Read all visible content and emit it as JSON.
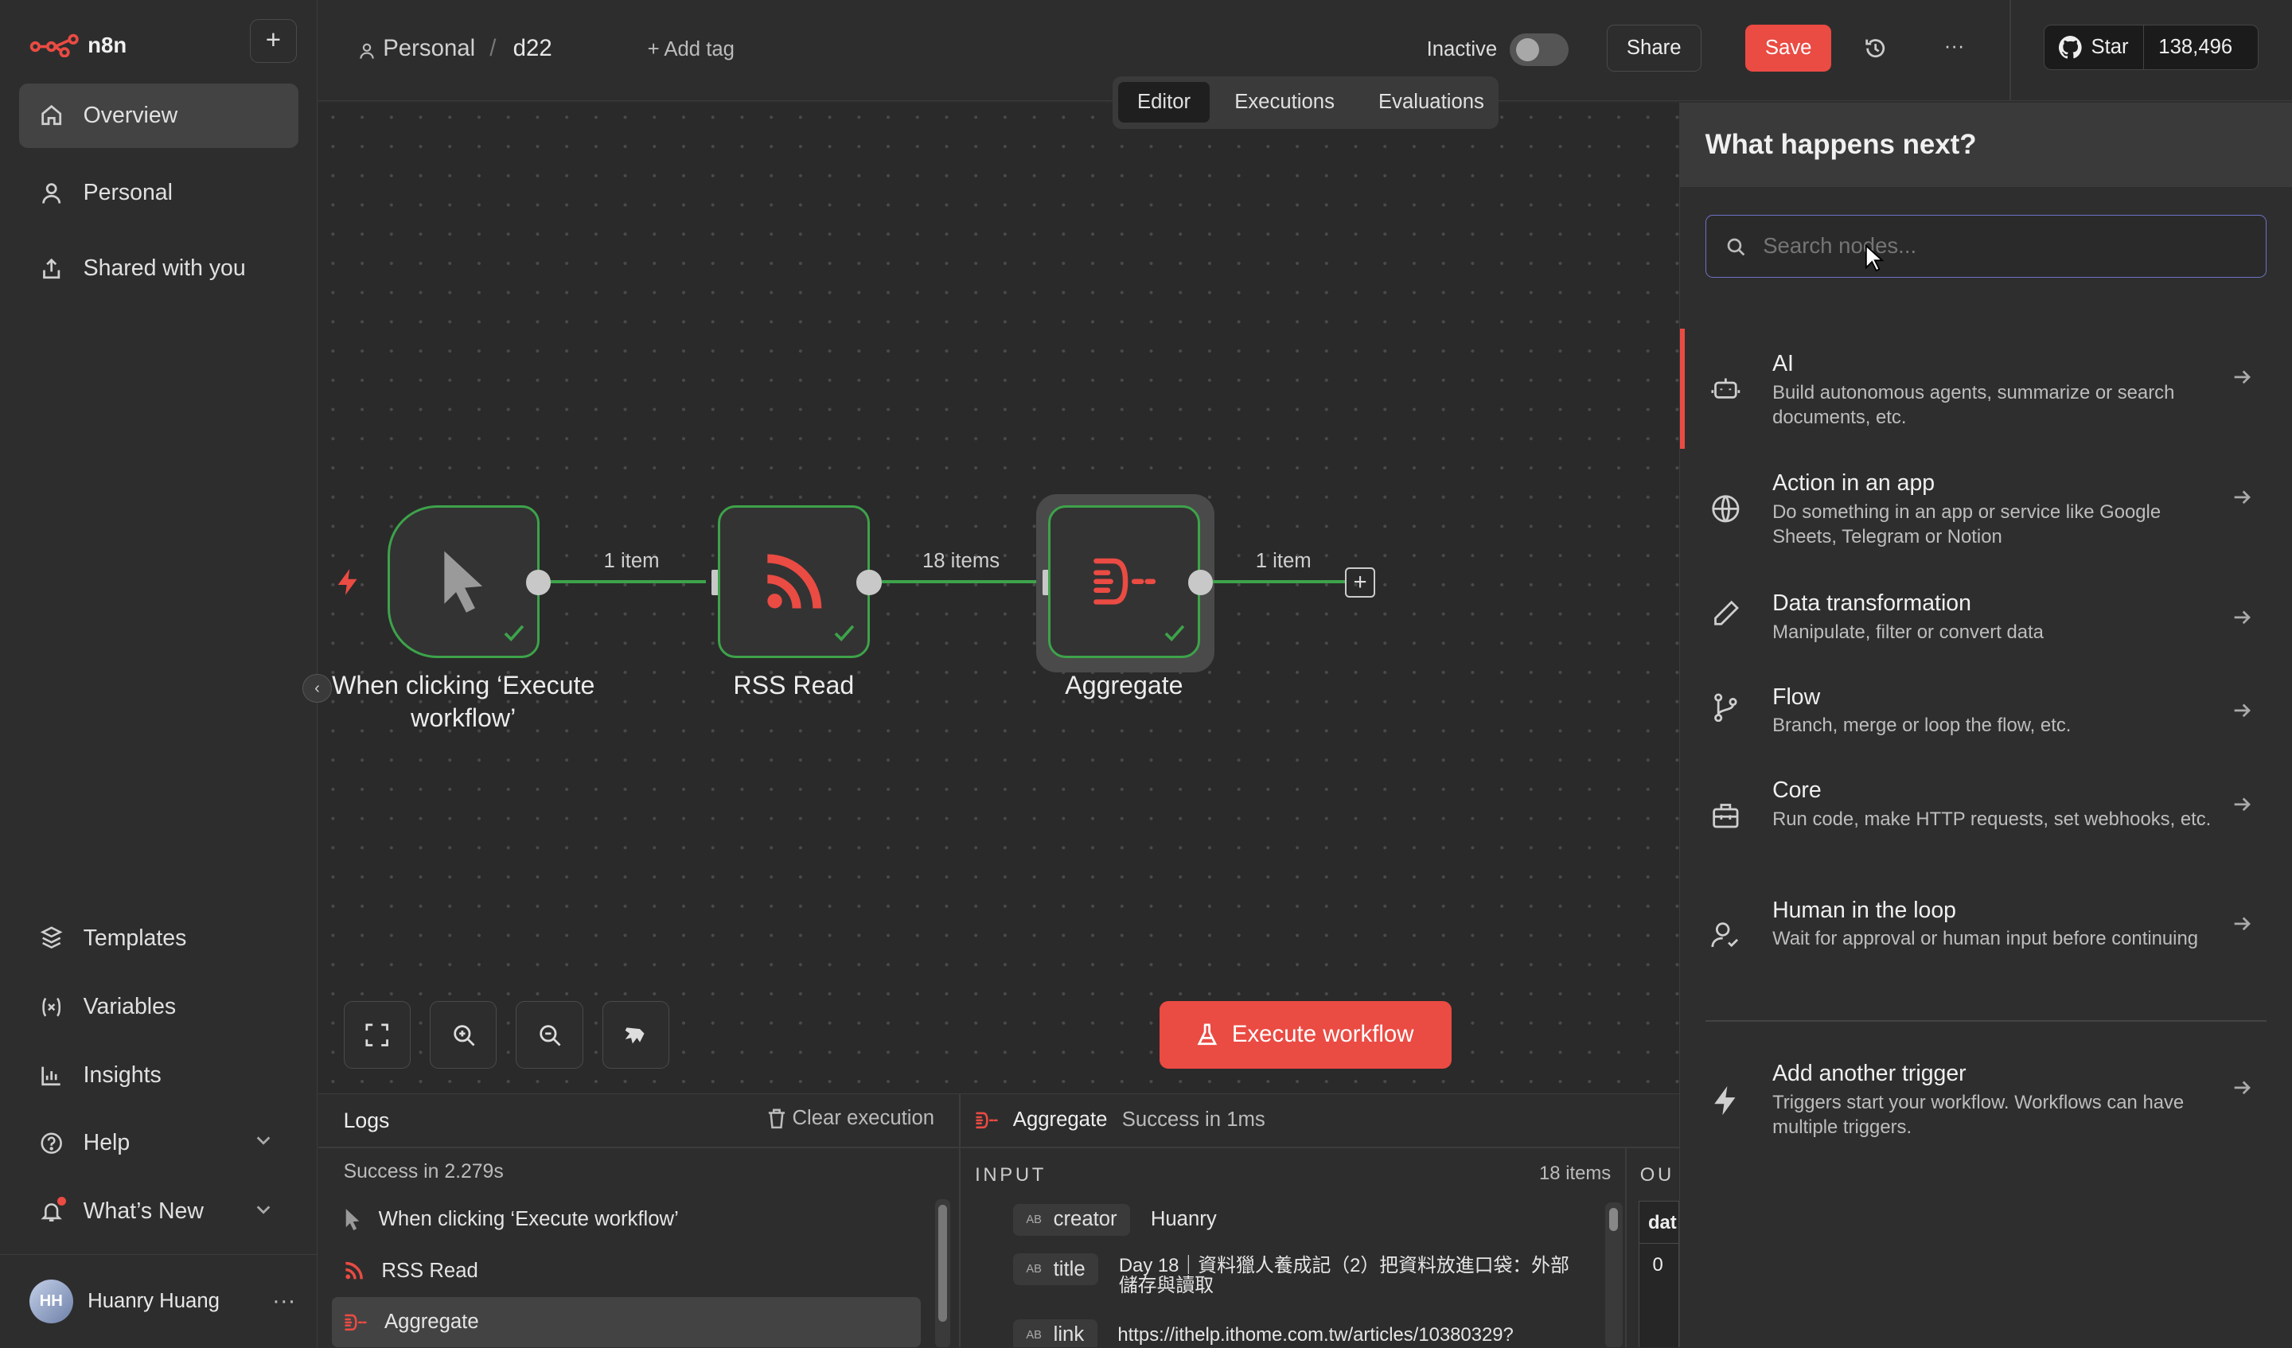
{
  "app": {
    "name": "n8n"
  },
  "sidebar": {
    "add_label": "+",
    "items": [
      {
        "label": "Overview"
      },
      {
        "label": "Personal"
      },
      {
        "label": "Shared with you"
      }
    ],
    "bottom_items": [
      {
        "label": "Templates"
      },
      {
        "label": "Variables"
      },
      {
        "label": "Insights"
      },
      {
        "label": "Help"
      },
      {
        "label": "What’s New"
      }
    ],
    "user": {
      "initials": "HH",
      "name": "Huanry Huang"
    }
  },
  "header": {
    "project": "Personal",
    "separator": "/",
    "workflow_name": "d22",
    "add_tag": "+ Add tag",
    "status_label": "Inactive",
    "share_label": "Share",
    "save_label": "Save",
    "more_label": "···",
    "github_star_label": "Star",
    "github_star_count": "138,496"
  },
  "tabs": [
    {
      "label": "Editor",
      "active": true
    },
    {
      "label": "Executions",
      "active": false
    },
    {
      "label": "Evaluations",
      "active": false
    }
  ],
  "canvas": {
    "nodes": [
      {
        "label": "When clicking ‘Execute workflow’"
      },
      {
        "label": "RSS Read"
      },
      {
        "label": "Aggregate"
      }
    ],
    "connections": [
      {
        "label": "1 item"
      },
      {
        "label": "18 items"
      },
      {
        "label": "1 item"
      }
    ],
    "execute_label": "Execute workflow"
  },
  "panel": {
    "title": "What happens next?",
    "search_placeholder": "Search nodes...",
    "categories": [
      {
        "title": "AI",
        "desc": "Build autonomous agents, summarize or search documents, etc.",
        "icon": "robot-icon"
      },
      {
        "title": "Action in an app",
        "desc": "Do something in an app or service like Google Sheets, Telegram or Notion",
        "icon": "globe-icon"
      },
      {
        "title": "Data transformation",
        "desc": "Manipulate, filter or convert data",
        "icon": "pen-icon"
      },
      {
        "title": "Flow",
        "desc": "Branch, merge or loop the flow, etc.",
        "icon": "branch-icon"
      },
      {
        "title": "Core",
        "desc": "Run code, make HTTP requests, set webhooks, etc.",
        "icon": "toolbox-icon"
      },
      {
        "title": "Human in the loop",
        "desc": "Wait for approval or human input before continuing",
        "icon": "user-check-icon"
      }
    ],
    "trigger": {
      "title": "Add another trigger",
      "desc": "Triggers start your workflow. Workflows can have multiple triggers.",
      "icon": "bolt-icon"
    }
  },
  "logs": {
    "title": "Logs",
    "clear_label": "Clear execution",
    "summary": "Success in 2.279s",
    "entries": [
      {
        "label": "When clicking ‘Execute workflow’"
      },
      {
        "label": "RSS Read"
      },
      {
        "label": "Aggregate"
      }
    ],
    "detail": {
      "node": "Aggregate",
      "status": "Success in 1ms",
      "input_label": "INPUT",
      "items_count": "18 items",
      "output_label": "OU",
      "fields": [
        {
          "key": "creator",
          "value": "Huanry"
        },
        {
          "key": "title",
          "value": "Day 18｜資料獵人養成記（2）把資料放進口袋：外部儲存與讀取"
        },
        {
          "key": "link",
          "value": "https://ithelp.ithome.com.tw/articles/10380329?"
        }
      ],
      "output_col": "dat",
      "output_row": "0"
    }
  },
  "colors": {
    "accent": "#ea4b43",
    "success": "#3da34a",
    "focus": "#6d73c7"
  }
}
